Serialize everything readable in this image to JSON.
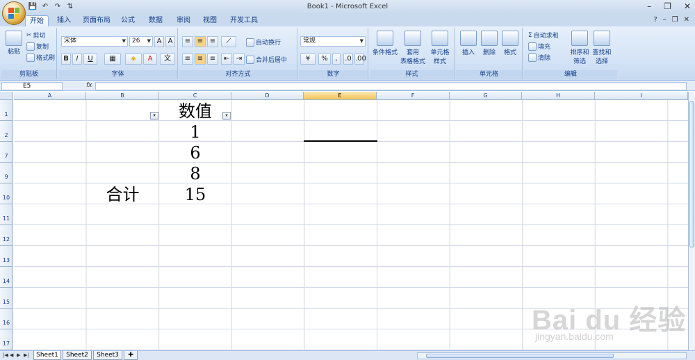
{
  "window": {
    "title": "Book1 - Microsoft Excel"
  },
  "tabs": [
    "开始",
    "插入",
    "页面布局",
    "公式",
    "数据",
    "审阅",
    "视图",
    "开发工具"
  ],
  "ribbon": {
    "clipboard": {
      "label": "剪贴板",
      "paste": "粘贴",
      "cut": "剪切",
      "copy": "复制",
      "format_painter": "格式刷"
    },
    "font": {
      "label": "字体",
      "name": "宋体",
      "size": "26",
      "bold": "B",
      "italic": "I",
      "underline": "U"
    },
    "alignment": {
      "label": "对齐方式",
      "wrap": "自动换行",
      "merge": "合并后居中"
    },
    "number": {
      "label": "数字",
      "format": "常规",
      "percent": "%"
    },
    "styles": {
      "label": "样式",
      "conditional": "条件格式",
      "table": "套用\n表格格式",
      "cell_styles": "单元格\n样式"
    },
    "cells": {
      "label": "单元格",
      "insert": "插入",
      "delete": "删除",
      "format": "格式"
    },
    "editing": {
      "label": "编辑",
      "autosum": "自动求和",
      "fill": "填充",
      "clear": "清除",
      "sort": "排序和\n筛选",
      "find": "查找和\n选择"
    }
  },
  "formula_bar": {
    "name_box": "E5",
    "fx": "fx",
    "value": ""
  },
  "columns": [
    "A",
    "B",
    "C",
    "D",
    "E",
    "F",
    "G",
    "H",
    "I"
  ],
  "selected_column": "E",
  "rows": [
    "1",
    "2",
    "7",
    "9",
    "10",
    "11",
    "12",
    "13",
    "14",
    "15",
    "16",
    "17"
  ],
  "cells": {
    "c1": "数值",
    "c2": "1",
    "c7": "6",
    "c9": "8",
    "b10": "合计",
    "c10": "15"
  },
  "sheets": [
    "Sheet1",
    "Sheet2",
    "Sheet3"
  ],
  "active_sheet": "Sheet1",
  "watermark": {
    "main": "Bai du 经验",
    "sub": "jingyan.baidu.com"
  },
  "colors": {
    "accent": "#15428b",
    "selected_header": "#f5c55a",
    "grid": "#d0d7e5"
  }
}
